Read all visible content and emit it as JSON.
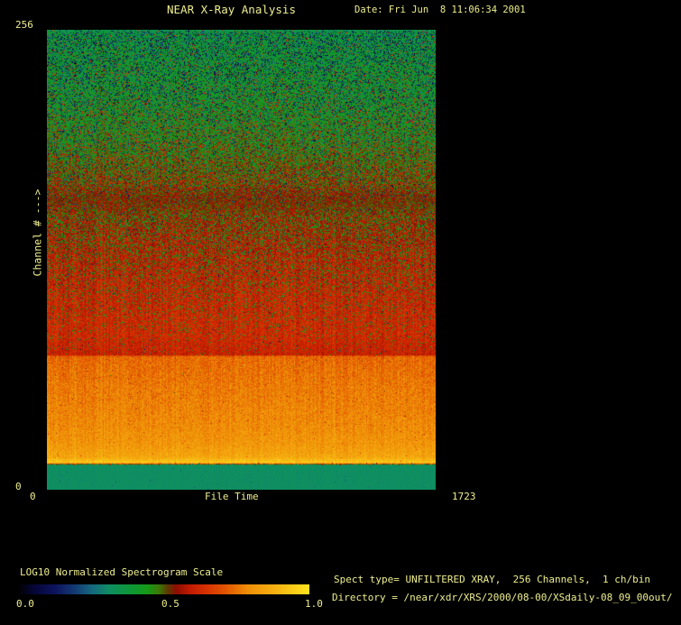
{
  "window": {
    "background": "#000000",
    "text_color": "#eeee8e"
  },
  "header": {
    "title": "NEAR X-Ray Analysis",
    "date": "Date: Fri Jun  8 11:06:34 2001"
  },
  "plot": {
    "y_axis": {
      "max_label": "256",
      "min_label": "0",
      "title": "Channel # --->"
    },
    "x_axis": {
      "min_label": "0",
      "title": "File Time",
      "max_label": "1723"
    }
  },
  "colorbar": {
    "label": "LOG10 Normalized Spectrogram Scale",
    "tick_labels": [
      "0.0",
      "0.5",
      "1.0"
    ]
  },
  "info": {
    "spect_line": "Spect type= UNFILTERED XRAY,  256 Channels,  1 ch/bin",
    "directory_line": "Directory = /near/xdr/XRS/2000/08-00/XSdaily-08_09_00out/"
  },
  "chart_data": {
    "type": "heatmap",
    "title": "NEAR X-Ray Analysis",
    "xlabel": "File Time",
    "ylabel": "Channel # --->",
    "x_range": [
      0,
      1723
    ],
    "y_range": [
      0,
      256
    ],
    "x_ticks": [
      0,
      1723
    ],
    "y_ticks": [
      0,
      256
    ],
    "grid": false,
    "legend_position": "colorbar bottom-left",
    "colorbar": {
      "label": "LOG10 Normalized Spectrogram Scale",
      "ticks": [
        0.0,
        0.5,
        1.0
      ],
      "scale": "LOG10 normalized intensity 0-1"
    },
    "colormap_stops": [
      [
        0.0,
        "#020208"
      ],
      [
        0.05,
        "#06063a"
      ],
      [
        0.12,
        "#0e145e"
      ],
      [
        0.19,
        "#133c74"
      ],
      [
        0.25,
        "#166a80"
      ],
      [
        0.31,
        "#0f8f62"
      ],
      [
        0.38,
        "#0e9838"
      ],
      [
        0.44,
        "#169a18"
      ],
      [
        0.48,
        "#3d7a08"
      ],
      [
        0.51,
        "#5c3c00"
      ],
      [
        0.54,
        "#8c0e00"
      ],
      [
        0.59,
        "#c41c00"
      ],
      [
        0.64,
        "#d63000"
      ],
      [
        0.71,
        "#e25600"
      ],
      [
        0.79,
        "#f09008"
      ],
      [
        0.87,
        "#f5ad10"
      ],
      [
        1.0,
        "#ffe41f"
      ]
    ],
    "bands": [
      {
        "channels": [
          199,
          256
        ],
        "value_range": [
          0.35,
          0.45
        ],
        "appearance": "noisy green with dense dark-navy/black speckles, sparse red specks"
      },
      {
        "channels": [
          152,
          199
        ],
        "value_range": [
          0.44,
          0.57
        ],
        "appearance": "mottled green-to-red transition"
      },
      {
        "channels": [
          75,
          152
        ],
        "value_range": [
          0.57,
          0.62
        ],
        "appearance": "red with green speckles thinning toward lower channels"
      },
      {
        "channels": [
          14,
          75
        ],
        "value_range": [
          0.74,
          0.93
        ],
        "appearance": "smooth orange band brightening to yellow at lowest rows"
      },
      {
        "channels": [
          0,
          14
        ],
        "value_range": [
          0.31,
          0.31
        ],
        "appearance": "flat solid teal-green band"
      }
    ],
    "row_profile_keyframes": [
      [
        256,
        0.35,
        0.03,
        0.06,
        0.05,
        0.25,
        0.02,
        0.56,
        0.64
      ],
      [
        254,
        0.385,
        0.05,
        0.3,
        0.02,
        0.28,
        0.03,
        0.56,
        0.66
      ],
      [
        238,
        0.4,
        0.055,
        0.26,
        0.02,
        0.28,
        0.05,
        0.56,
        0.66
      ],
      [
        215,
        0.415,
        0.06,
        0.2,
        0.03,
        0.29,
        0.09,
        0.56,
        0.66
      ],
      [
        192,
        0.44,
        0.07,
        0.13,
        0.04,
        0.3,
        0.17,
        0.56,
        0.66
      ],
      [
        170,
        0.49,
        0.075,
        0.08,
        0.05,
        0.3,
        0.27,
        0.57,
        0.66
      ],
      [
        152,
        0.565,
        0.055,
        0.045,
        0.05,
        0.32,
        0.32,
        0.4,
        0.47
      ],
      [
        130,
        0.59,
        0.05,
        0.03,
        0.06,
        0.34,
        0.22,
        0.4,
        0.47
      ],
      [
        106,
        0.61,
        0.05,
        0.02,
        0.06,
        0.36,
        0.13,
        0.4,
        0.47
      ],
      [
        86,
        0.62,
        0.045,
        0.015,
        0.08,
        0.38,
        0.065,
        0.4,
        0.47
      ],
      [
        77,
        0.605,
        0.04,
        0.015,
        0.08,
        0.38,
        0.03,
        0.41,
        0.46
      ],
      [
        74.8,
        0.6,
        0.04,
        0.01,
        0.3,
        0.45,
        0.02,
        0.41,
        0.46
      ],
      [
        74.2,
        0.735,
        0.05,
        0.006,
        0.45,
        0.55,
        0.012,
        0.62,
        0.68
      ],
      [
        56,
        0.762,
        0.05,
        0.005,
        0.5,
        0.6,
        0.01,
        0.64,
        0.7
      ],
      [
        36,
        0.788,
        0.05,
        0.004,
        0.55,
        0.62,
        0.008,
        0.66,
        0.72
      ],
      [
        25,
        0.812,
        0.05,
        0.003,
        0.58,
        0.65,
        0.0,
        0.7,
        0.75
      ],
      [
        18,
        0.85,
        0.045,
        0.002,
        0.6,
        0.66,
        0.0,
        0.7,
        0.75
      ],
      [
        15.2,
        0.93,
        0.04,
        0.002,
        0.6,
        0.66,
        0.0,
        0.7,
        0.75
      ],
      [
        14.4,
        0.88,
        0.05,
        0.01,
        0.5,
        0.6,
        0.0,
        0.7,
        0.75
      ],
      [
        14.0,
        0.56,
        0.1,
        0.12,
        0.1,
        0.3,
        0.15,
        0.7,
        0.8
      ],
      [
        13.5,
        0.31,
        0.008,
        0.002,
        0.2,
        0.28,
        0.0,
        0.5,
        0.5
      ],
      [
        0,
        0.31,
        0.008,
        0.002,
        0.2,
        0.28,
        0.0,
        0.5,
        0.5
      ]
    ],
    "noise_seed": 20010608
  }
}
